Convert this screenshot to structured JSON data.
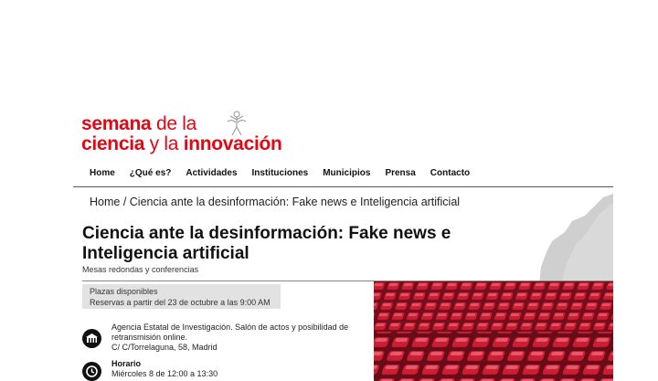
{
  "logo": {
    "line1_bold": "semana",
    "line1_thin": " de la",
    "line2_bold": "ciencia",
    "line2_thin": " y la ",
    "line2_bold2": "innovación"
  },
  "nav": {
    "items": [
      "Home",
      "¿Qué es?",
      "Actividades",
      "Instituciones",
      "Municipios",
      "Prensa",
      "Contacto"
    ]
  },
  "breadcrumb": {
    "home": "Home",
    "separator": " / ",
    "current": "Ciencia ante la desinformación: Fake news e Inteligencia artificial"
  },
  "event": {
    "title": "Ciencia ante la desinformación: Fake news e Inteligencia artificial",
    "category": "Mesas redondas y conferencias",
    "availability": "Plazas disponibles",
    "reservation": "Reservas a partir del 23 de octubre a las 9:00 AM",
    "location_line1": "Agencia Estatal de Investigación. Salón de actos y posibilidad de retransmisión online.",
    "location_line2": "C/ C/Torrelaguna, 58, Madrid",
    "schedule_label": "Horario",
    "schedule_value": "Miércoles 8 de 12:00 a 13:30"
  },
  "icons": {
    "location": "building-icon",
    "schedule": "clock-icon"
  },
  "colors": {
    "brand_red": "#e30613",
    "seat_red": "#d81f36"
  }
}
